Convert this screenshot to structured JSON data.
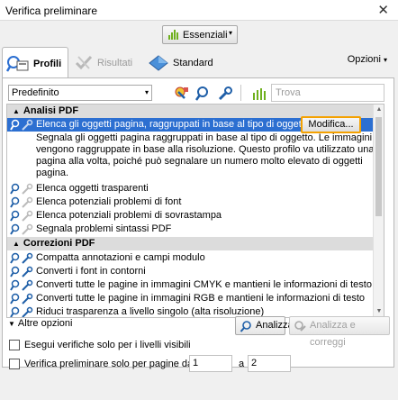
{
  "window": {
    "title": "Verifica preliminare",
    "close_glyph": "✕"
  },
  "toolbar_top": {
    "essentials_label": "Essenziali",
    "essentials_arrow": "▾"
  },
  "tabs": [
    {
      "label": "Profili",
      "icon": "profiles-icon",
      "active": true
    },
    {
      "label": "Risultati",
      "icon": "results-icon",
      "active": false
    },
    {
      "label": "Standard",
      "icon": "standard-icon",
      "active": false
    }
  ],
  "options": {
    "label": "Opzioni",
    "arrow": "▾"
  },
  "filter": {
    "select_value": "Predefinito",
    "select_arrow": "▾",
    "search_placeholder": "Trova"
  },
  "groups": [
    {
      "title": "Analisi PDF",
      "items": [
        {
          "label": "Elenca gli oggetti pagina, raggruppati in base al tipo di oggetto",
          "selected": true
        },
        {
          "label": "Elenca oggetti trasparenti"
        },
        {
          "label": "Elenca potenziali problemi di font"
        },
        {
          "label": "Elenca potenziali problemi di sovrastampa"
        },
        {
          "label": "Segnala problemi sintassi PDF"
        }
      ]
    },
    {
      "title": "Correzioni PDF",
      "items": [
        {
          "label": "Compatta annotazioni e campi modulo"
        },
        {
          "label": "Converti i font in contorni"
        },
        {
          "label": "Converti tutte le pagine in immagini CMYK e mantieni le informazioni di testo"
        },
        {
          "label": "Converti tutte le pagine in immagini RGB e mantieni le informazioni di testo"
        },
        {
          "label": "Riduci trasparenza a livello singolo (alta risoluzione)"
        }
      ]
    }
  ],
  "selected_description": "Segnala gli oggetti pagina raggruppati in base al tipo di oggetto. Le immagini vengono raggruppate in base alla risoluzione. Questo profilo va utilizzato una pagina alla volta, poiché può segnalare un numero molto elevato di oggetti pagina.",
  "modify_button": "Modifica...",
  "more_options": "Altre opzioni",
  "analyze_button": "Analizza",
  "analyze_fix_button": "Analizza e correggi",
  "checkboxes": {
    "visible_layers": "Esegui verifiche solo per i livelli visibili",
    "page_range": "Verifica preliminare solo per pagine da",
    "from_value": "1",
    "to_label": "a",
    "to_value": "2"
  },
  "colors": {
    "selection": "#2c6fd1",
    "highlight": "#f4a100",
    "accent_green": "#6fb01e"
  }
}
